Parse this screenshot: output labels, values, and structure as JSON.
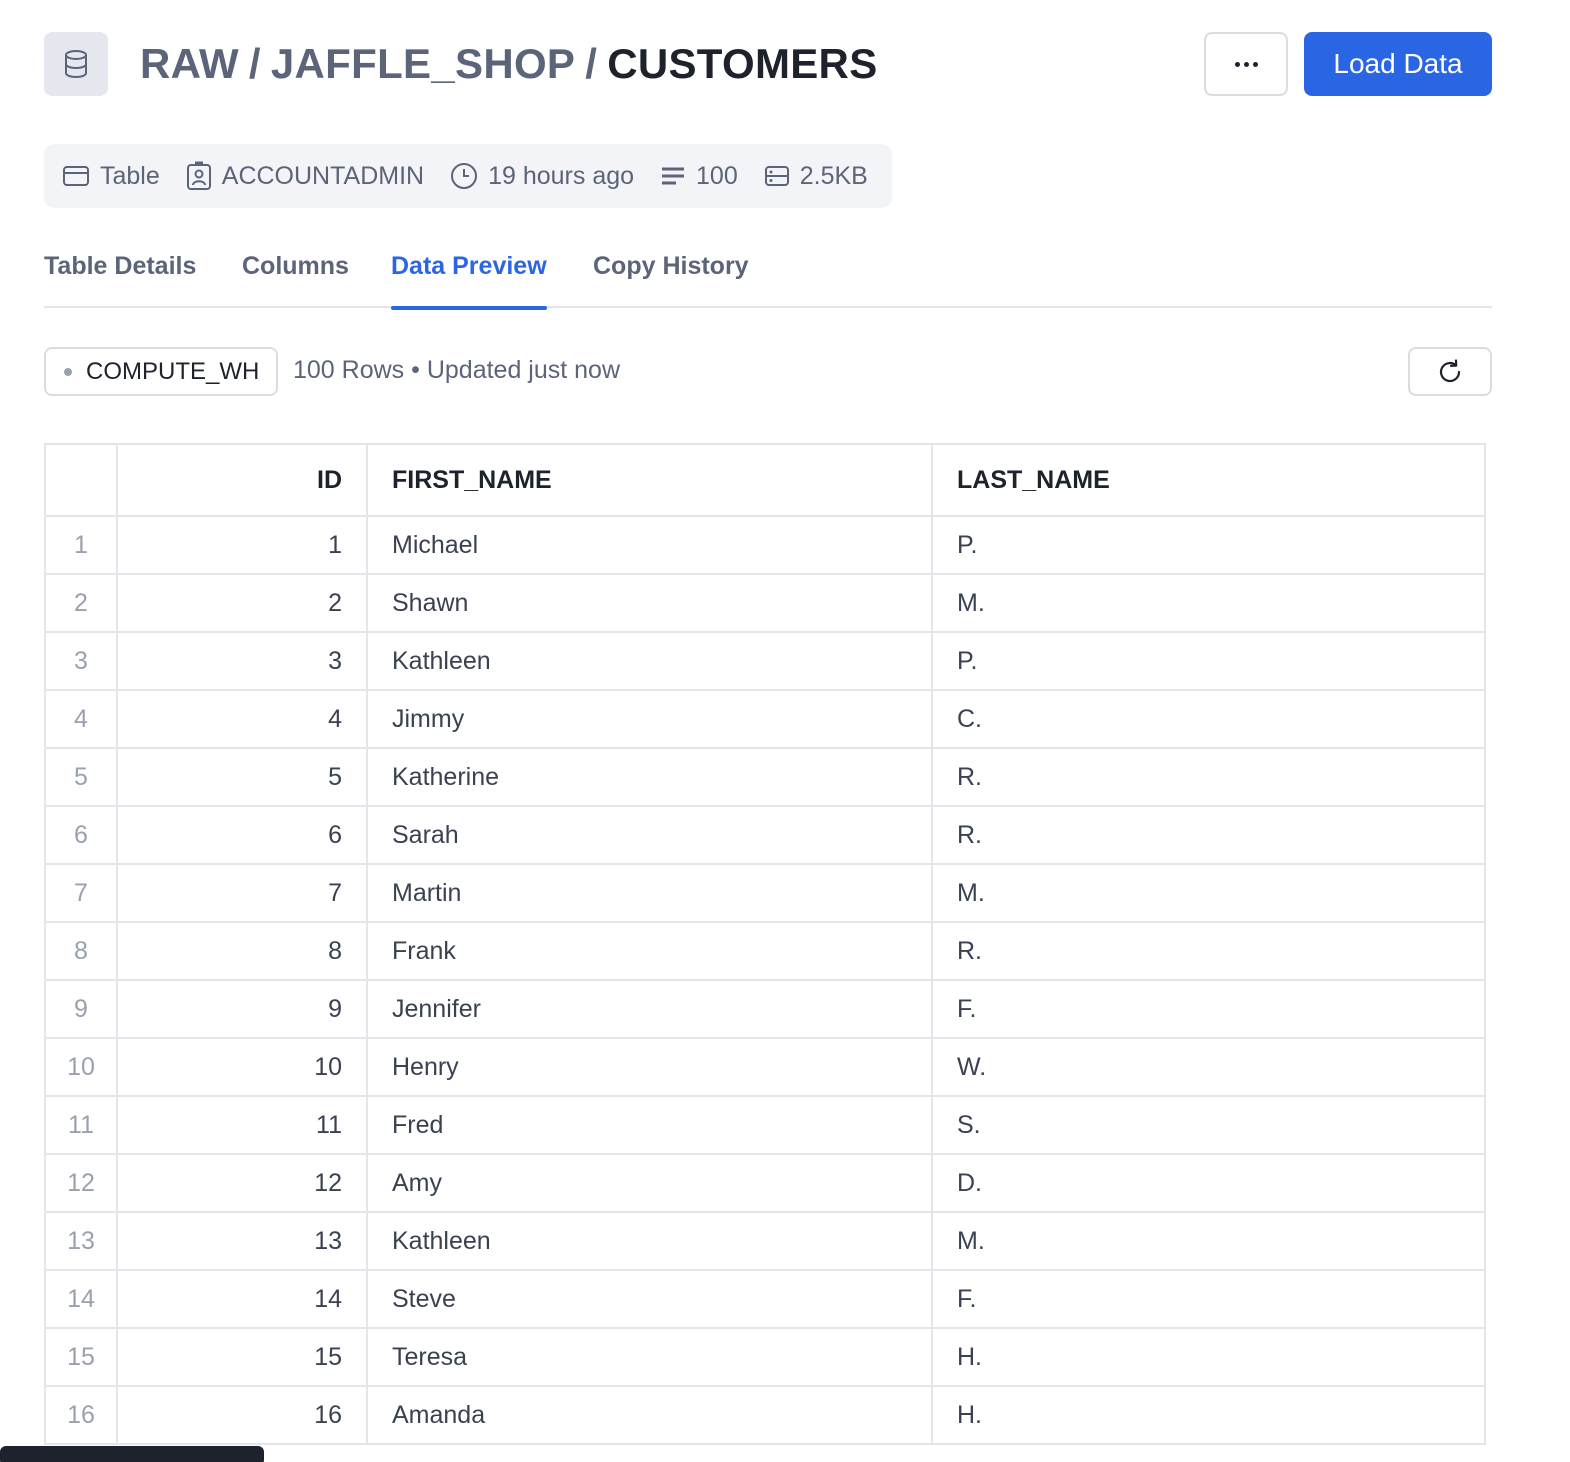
{
  "header": {
    "icon": "database-icon",
    "breadcrumb": [
      "RAW",
      "JAFFLE_SHOP"
    ],
    "separator": "/",
    "current": "CUSTOMERS",
    "more_label": "...",
    "load_button": "Load Data"
  },
  "meta": {
    "type": {
      "icon": "table-icon",
      "label": "Table"
    },
    "owner": {
      "icon": "user-badge-icon",
      "label": "ACCOUNTADMIN"
    },
    "updated": {
      "icon": "clock-icon",
      "label": "19 hours ago"
    },
    "rows": {
      "icon": "rows-icon",
      "label": "100"
    },
    "size": {
      "icon": "storage-icon",
      "label": "2.5KB"
    }
  },
  "tabs": [
    {
      "label": "Table Details",
      "active": false
    },
    {
      "label": "Columns",
      "active": false
    },
    {
      "label": "Data Preview",
      "active": true
    },
    {
      "label": "Copy History",
      "active": false
    }
  ],
  "toolbar": {
    "warehouse": "COMPUTE_WH",
    "row_count": "100 Rows",
    "bullet": "•",
    "updated": "Updated just now",
    "refresh_icon": "refresh-icon"
  },
  "table": {
    "columns": [
      "",
      "ID",
      "FIRST_NAME",
      "LAST_NAME"
    ],
    "rows": [
      [
        "1",
        "1",
        "Michael",
        "P."
      ],
      [
        "2",
        "2",
        "Shawn",
        "M."
      ],
      [
        "3",
        "3",
        "Kathleen",
        "P."
      ],
      [
        "4",
        "4",
        "Jimmy",
        "C."
      ],
      [
        "5",
        "5",
        "Katherine",
        "R."
      ],
      [
        "6",
        "6",
        "Sarah",
        "R."
      ],
      [
        "7",
        "7",
        "Martin",
        "M."
      ],
      [
        "8",
        "8",
        "Frank",
        "R."
      ],
      [
        "9",
        "9",
        "Jennifer",
        "F."
      ],
      [
        "10",
        "10",
        "Henry",
        "W."
      ],
      [
        "11",
        "11",
        "Fred",
        "S."
      ],
      [
        "12",
        "12",
        "Amy",
        "D."
      ],
      [
        "13",
        "13",
        "Kathleen",
        "M."
      ],
      [
        "14",
        "14",
        "Steve",
        "F."
      ],
      [
        "15",
        "15",
        "Teresa",
        "H."
      ],
      [
        "16",
        "16",
        "Amanda",
        "H."
      ]
    ]
  },
  "colors": {
    "accent": "#2a66e3",
    "muted_text": "#5b6478",
    "border": "#e2e5ea"
  }
}
